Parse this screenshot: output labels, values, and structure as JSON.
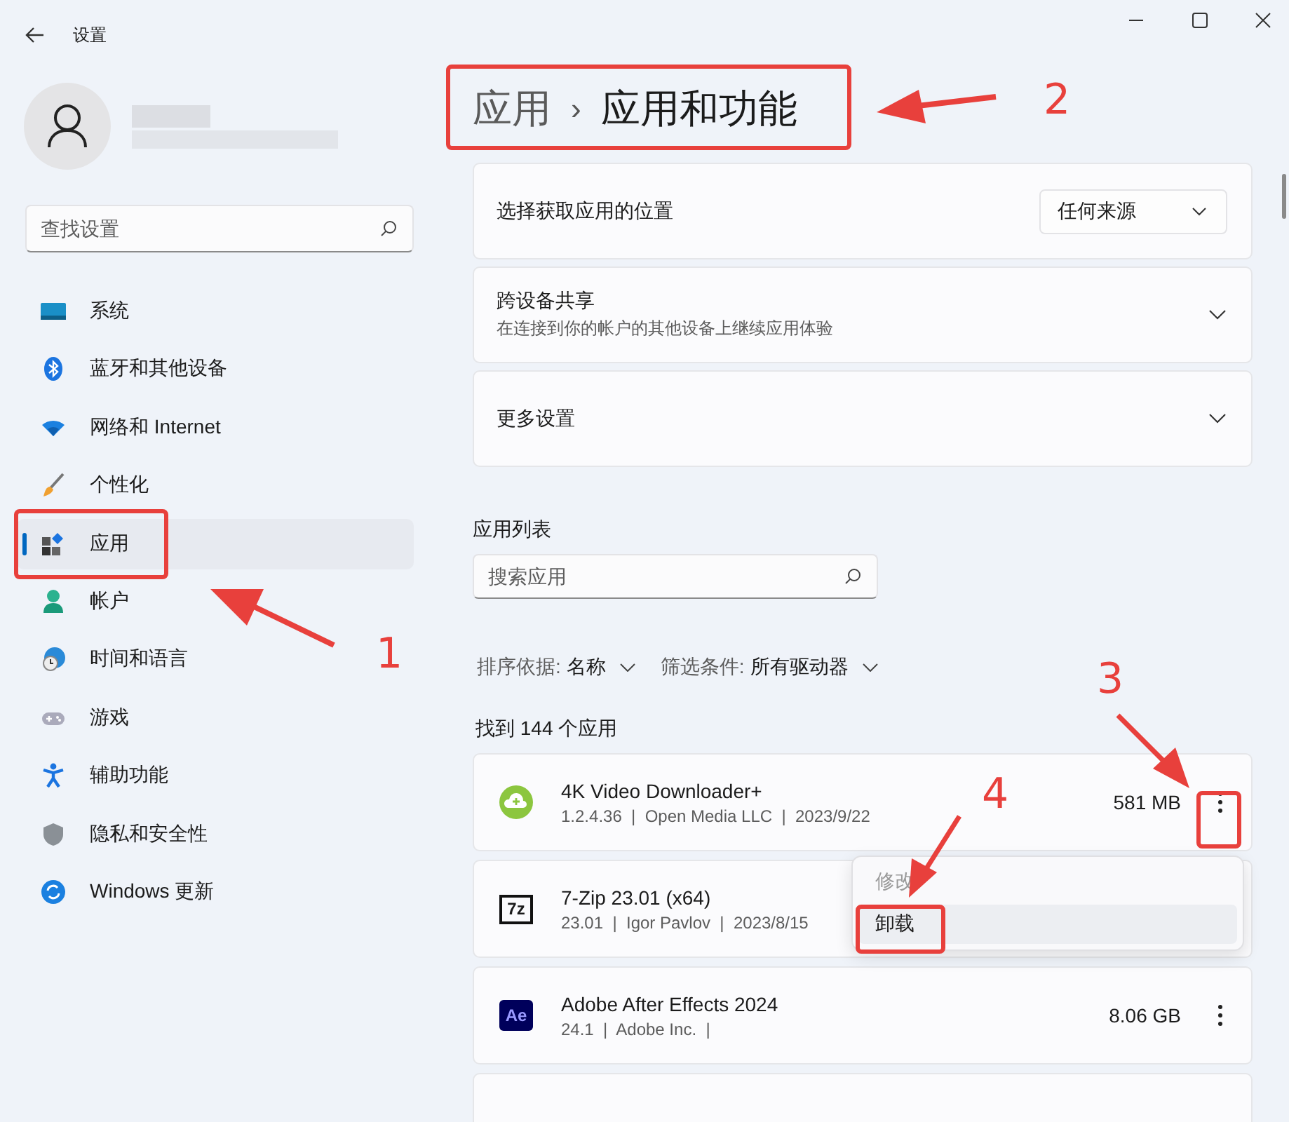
{
  "window": {
    "title": "设置"
  },
  "sidebar": {
    "search": {
      "placeholder": "查找设置"
    },
    "items": [
      {
        "label": "系统",
        "selected": false
      },
      {
        "label": "蓝牙和其他设备",
        "selected": false
      },
      {
        "label": "网络和 Internet",
        "selected": false
      },
      {
        "label": "个性化",
        "selected": false
      },
      {
        "label": "应用",
        "selected": true
      },
      {
        "label": "帐户",
        "selected": false
      },
      {
        "label": "时间和语言",
        "selected": false
      },
      {
        "label": "游戏",
        "selected": false
      },
      {
        "label": "辅助功能",
        "selected": false
      },
      {
        "label": "隐私和安全性",
        "selected": false
      },
      {
        "label": "Windows 更新",
        "selected": false
      }
    ]
  },
  "breadcrumb": {
    "parent": "应用",
    "separator": "›",
    "current": "应用和功能"
  },
  "settings": [
    {
      "kind": "dropdown",
      "title": "选择获取应用的位置",
      "value": "任何来源"
    },
    {
      "kind": "expander",
      "title": "跨设备共享",
      "subtitle": "在连接到你的帐户的其他设备上继续应用体验",
      "expanded": false
    },
    {
      "kind": "expander",
      "title": "更多设置",
      "expanded": false
    }
  ],
  "app_list": {
    "heading": "应用列表",
    "search": {
      "placeholder": "搜索应用"
    },
    "sort": {
      "label": "排序依据:",
      "value": "名称"
    },
    "filter": {
      "label": "筛选条件:",
      "value": "所有驱动器"
    },
    "count": "找到 144 个应用",
    "apps": [
      {
        "kind": "cloud",
        "name": "4K Video Downloader+",
        "meta": "1.2.4.36  |  Open Media LLC  |  2023/9/22",
        "size": "581 MB"
      },
      {
        "kind": "sevenzip",
        "icon_text": "7z",
        "name": "7-Zip 23.01 (x64)",
        "meta": "23.01  |  Igor Pavlov  |  2023/8/15"
      },
      {
        "kind": "ae",
        "icon_text": "Ae",
        "name": "Adobe After Effects 2024",
        "meta": "24.1  |  Adobe Inc.  |",
        "size": "8.06 GB"
      },
      {
        "kind": "partial"
      }
    ]
  },
  "context_menu": {
    "items": [
      {
        "label": "修改",
        "disabled": true,
        "selected": false
      },
      {
        "label": "卸载",
        "disabled": false,
        "selected": true
      }
    ]
  },
  "annotations": [
    {
      "label": "1"
    },
    {
      "label": "2"
    },
    {
      "label": "3"
    },
    {
      "label": "4"
    }
  ]
}
